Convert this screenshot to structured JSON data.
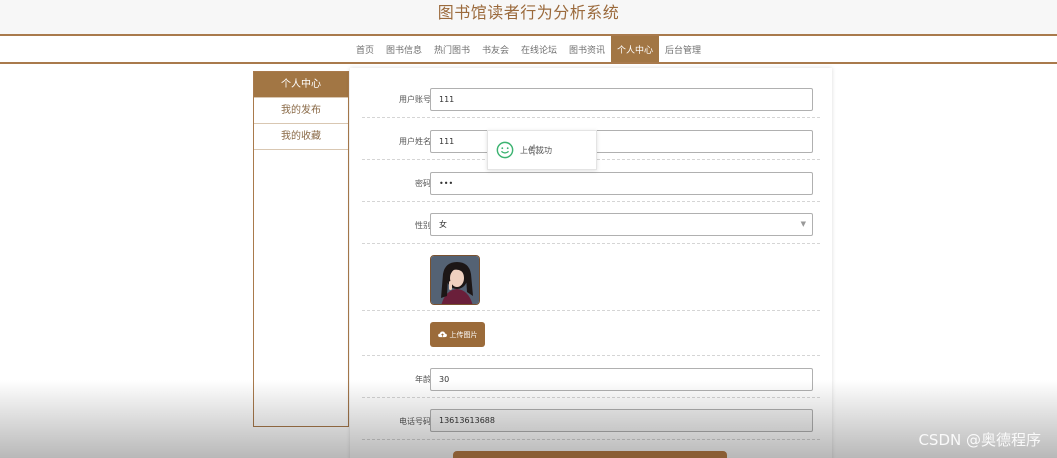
{
  "header": {
    "title": "图书馆读者行为分析系统"
  },
  "nav": {
    "items": [
      "首页",
      "图书信息",
      "热门图书",
      "书友会",
      "在线论坛",
      "图书资讯",
      "个人中心",
      "后台管理"
    ],
    "active_index": 6
  },
  "sidebar": {
    "items": [
      "个人中心",
      "我的发布",
      "我的收藏"
    ],
    "active_index": 0
  },
  "form": {
    "account": {
      "label": "用户账号",
      "value": "111"
    },
    "name": {
      "label": "用户姓名",
      "value": "111"
    },
    "password": {
      "label": "密码",
      "value": "•••"
    },
    "gender": {
      "label": "性别",
      "value": "女"
    },
    "upload_label": "上传图片",
    "age": {
      "label": "年龄",
      "value": "30"
    },
    "phone": {
      "label": "电话号码",
      "value": "13613613688"
    }
  },
  "toast": {
    "text": "上传成功"
  },
  "watermark": "CSDN @奥德程序",
  "colors": {
    "accent": "#a27644",
    "brand_text": "#9b6a3c"
  }
}
